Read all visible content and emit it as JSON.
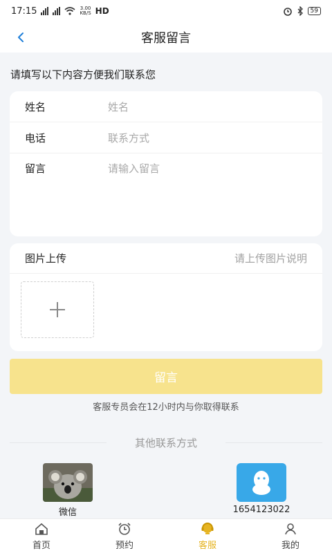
{
  "status_bar": {
    "time": "17:15",
    "net_speed_top": "3.00",
    "net_speed_bottom": "KB/S",
    "hd": "HD",
    "battery": "59"
  },
  "header": {
    "title": "客服留言",
    "back_icon": "chevron-left-icon"
  },
  "intro": "请填写以下内容方便我们联系您",
  "form": {
    "name_label": "姓名",
    "name_placeholder": "姓名",
    "phone_label": "电话",
    "phone_placeholder": "联系方式",
    "message_label": "留言",
    "message_placeholder": "请输入留言"
  },
  "upload": {
    "label": "图片上传",
    "hint": "请上传图片说明",
    "add_icon": "plus-icon"
  },
  "submit_label": "留言",
  "notice": "客服专员会在12小时内与你取得联系",
  "other_contacts": {
    "title": "其他联系方式",
    "wechat_label": "微信",
    "qq_label": "1654123022"
  },
  "tabs": [
    {
      "label": "首页",
      "icon": "home-icon"
    },
    {
      "label": "预约",
      "icon": "alarm-clock-icon"
    },
    {
      "label": "客服",
      "icon": "customer-service-icon",
      "active": true
    },
    {
      "label": "我的",
      "icon": "user-icon"
    }
  ],
  "colors": {
    "accent": "#e6b422",
    "submit_bg": "#f7e38d",
    "back_arrow": "#1f7fd9",
    "qq_blue": "#38a8e8",
    "page_bg": "#f3f5f8"
  }
}
